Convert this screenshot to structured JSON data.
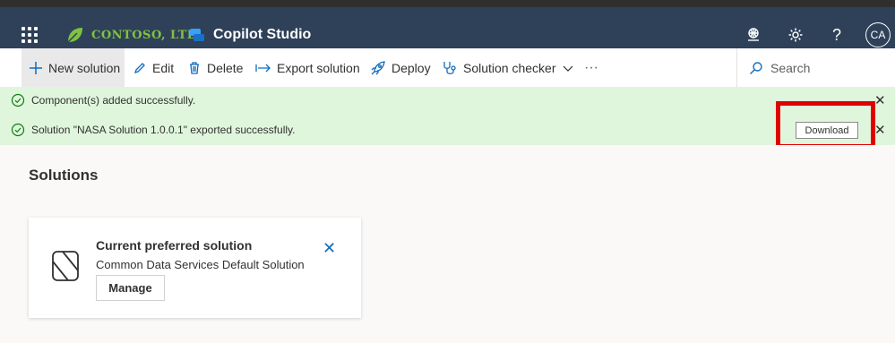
{
  "header": {
    "brand": "CONTOSO, LTD.",
    "product": "Copilot Studio",
    "avatar": "CA",
    "help_glyph": "?",
    "icons": [
      "waffle-icon",
      "environment-icon",
      "gear-icon",
      "help-icon"
    ]
  },
  "commands": {
    "new_solution": "New solution",
    "edit": "Edit",
    "delete": "Delete",
    "export": "Export solution",
    "deploy": "Deploy",
    "checker": "Solution checker",
    "more": "···",
    "search_placeholder": "Search"
  },
  "notifications": [
    {
      "text": "Component(s) added successfully."
    },
    {
      "text": "Solution \"NASA Solution 1.0.0.1\" exported successfully.",
      "action": "Download"
    }
  ],
  "main": {
    "title": "Solutions",
    "card": {
      "title": "Current preferred solution",
      "subtitle": "Common Data Services Default Solution",
      "button": "Manage"
    }
  },
  "colors": {
    "header_bg": "#2f4159",
    "success_bg": "#dff6dd",
    "highlight": "#e00000",
    "brand_green": "#7fc241"
  }
}
